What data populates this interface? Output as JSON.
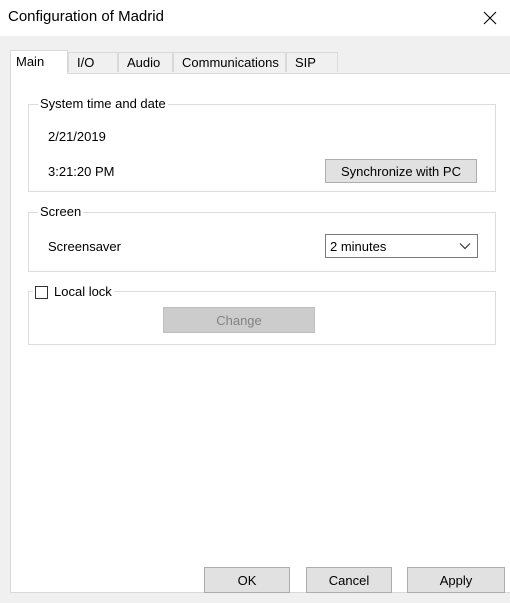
{
  "window": {
    "title": "Configuration of Madrid"
  },
  "tabs": [
    {
      "label": "Main",
      "active": true
    },
    {
      "label": "I/O",
      "active": false
    },
    {
      "label": "Audio",
      "active": false
    },
    {
      "label": "Communications",
      "active": false
    },
    {
      "label": "SIP",
      "active": false
    }
  ],
  "system_time": {
    "caption": "System time and date",
    "date": "2/21/2019",
    "time": "3:21:20 PM",
    "sync_button": "Synchronize with PC"
  },
  "screen": {
    "caption": "Screen",
    "screensaver_label": "Screensaver",
    "screensaver_value": "2 minutes"
  },
  "local_lock": {
    "caption": "Local lock",
    "checked": false,
    "change_button": "Change"
  },
  "footer": {
    "ok": "OK",
    "cancel": "Cancel",
    "apply": "Apply"
  },
  "icons": {
    "close": "close-icon",
    "dropdown": "chevron-down-icon"
  }
}
